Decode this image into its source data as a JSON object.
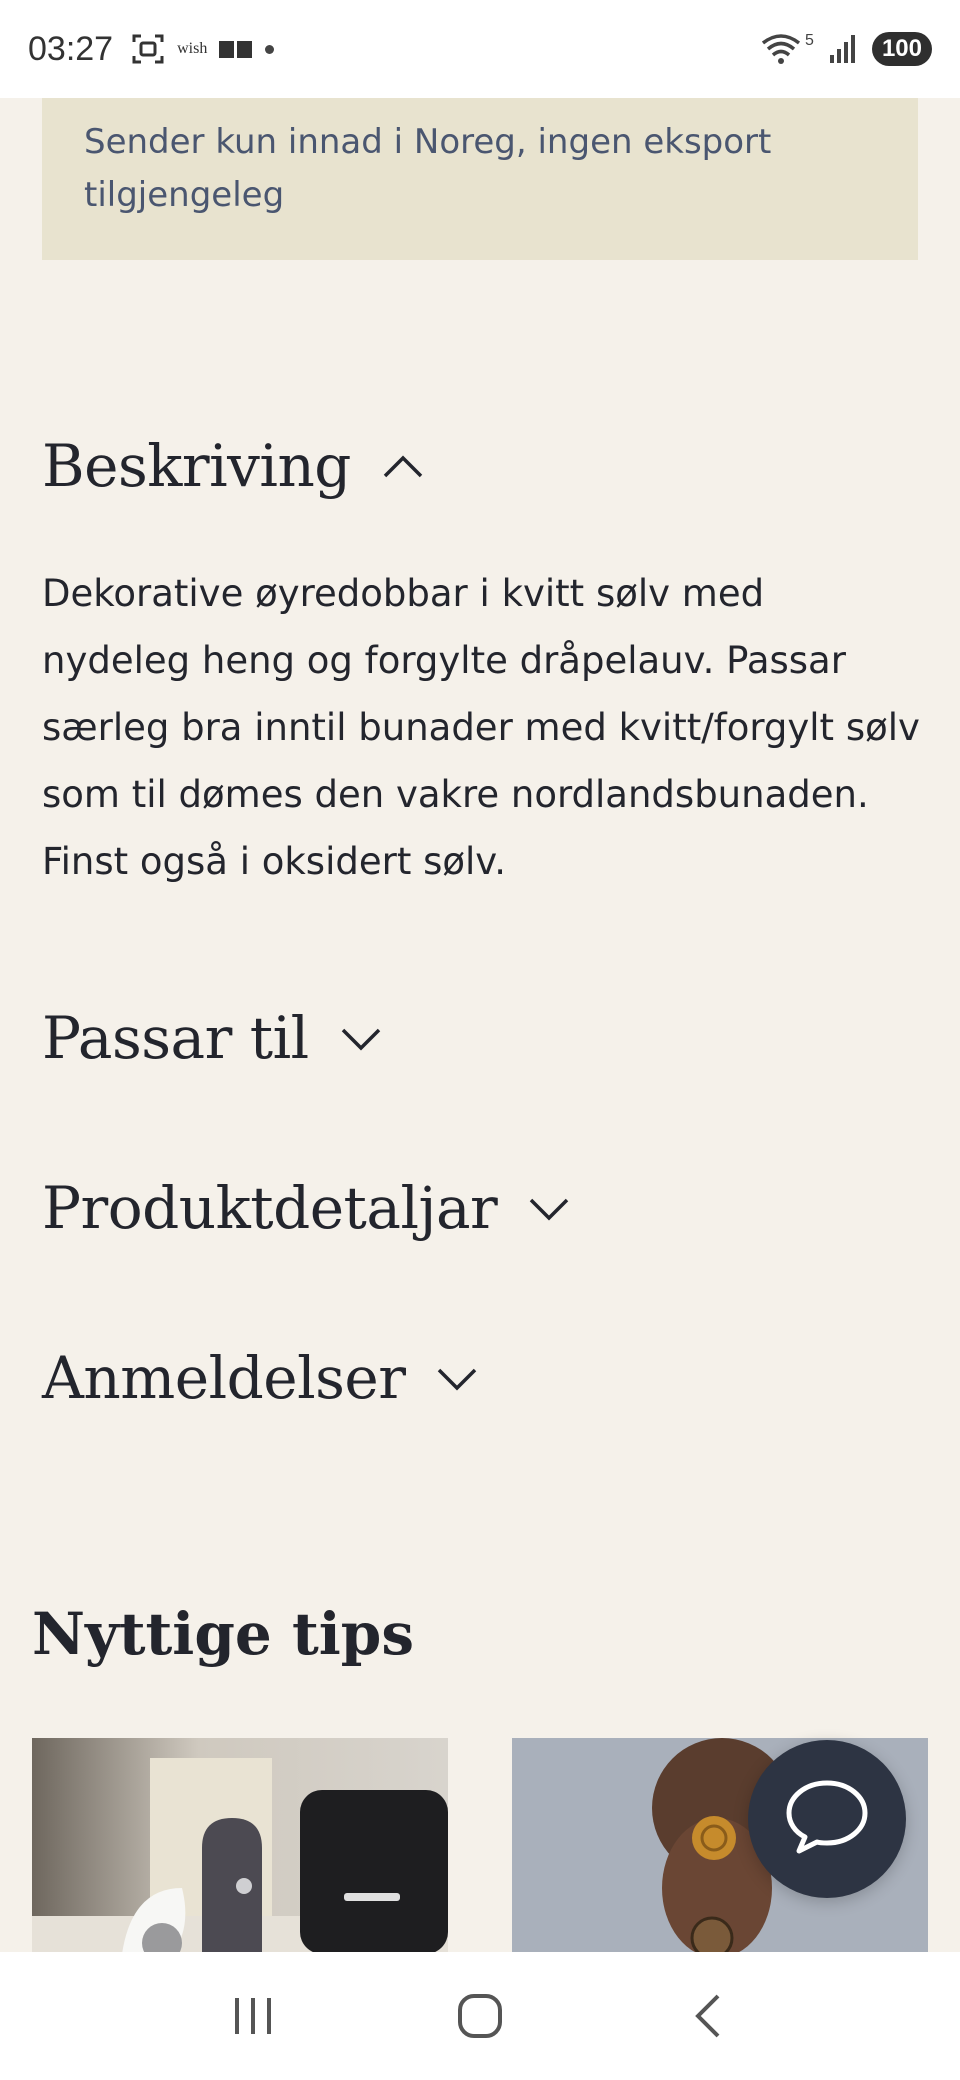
{
  "status_bar": {
    "time": "03:27",
    "wish_label": "wish",
    "network_label": "5",
    "battery": "100",
    "icons": [
      "screenshot-icon",
      "wish-app-icon",
      "notification-dot-icon",
      "wifi-icon",
      "signal-icon",
      "battery-icon"
    ]
  },
  "shipping_note": "Sender kun innad i Noreg, ingen eksport tilgjengeleg",
  "sections": {
    "description": {
      "title": "Beskriving",
      "expanded": true,
      "body": "Dekorative øyredobbar i kvitt sølv med nydeleg heng og forgylte dråpelauv. Passar særleg bra inntil bunader med kvitt/forgylt sølv som til dømes den vakre nordlandsbunaden. Finst også i oksidert sølv."
    },
    "fits": {
      "title": "Passar til",
      "expanded": false
    },
    "details": {
      "title": "Produktdetaljar",
      "expanded": false
    },
    "reviews": {
      "title": "Anmeldelser",
      "expanded": false
    }
  },
  "tips": {
    "title": "Nyttige tips"
  },
  "colors": {
    "background": "#f5f1ea",
    "shipping_box": "#e8e3cf",
    "chat_button": "#2d3443",
    "text": "#23252d"
  },
  "nav": {
    "icons": [
      "recent-apps-icon",
      "home-icon",
      "back-icon"
    ]
  }
}
